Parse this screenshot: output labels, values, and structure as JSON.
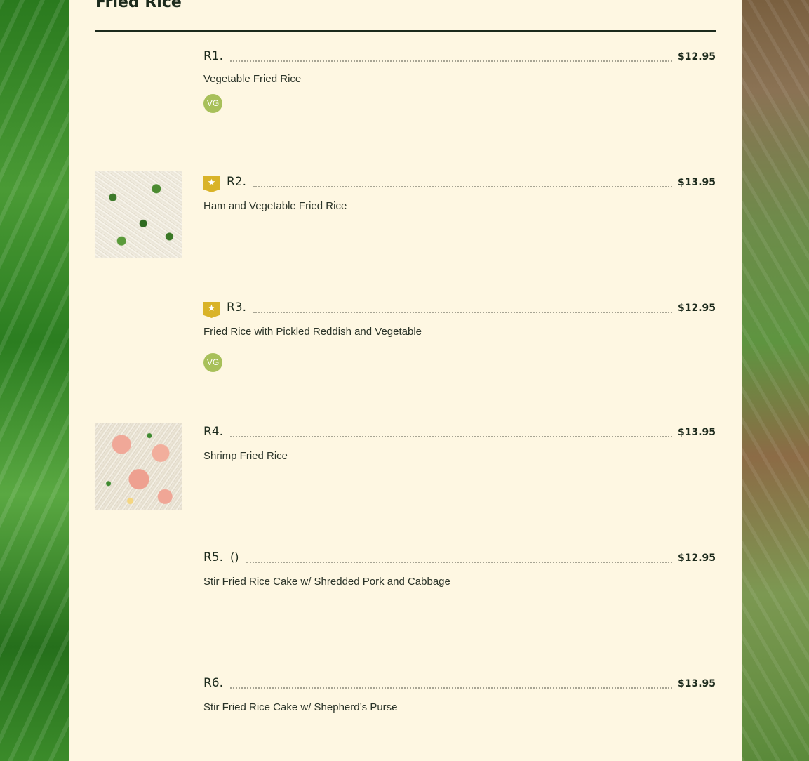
{
  "section": {
    "title": "Fried Rice"
  },
  "items": [
    {
      "code": "R1.",
      "price": "$12.95",
      "description": "Vegetable Fried Rice",
      "badge": "VG"
    },
    {
      "code": "R2.",
      "price": "$13.95",
      "description": "Ham and Vegetable Fried Rice",
      "star_icon": "star-icon"
    },
    {
      "code": "R3.",
      "price": "$12.95",
      "description": "Fried Rice with Pickled Reddish and Vegetable",
      "badge": "VG",
      "star_icon": "star-icon"
    },
    {
      "code": "R4.",
      "price": "$13.95",
      "description": "Shrimp Fried Rice"
    },
    {
      "code": "R5.",
      "subtitle": "()",
      "price": "$12.95",
      "description": "Stir Fried Rice Cake w/ Shredded Pork and Cabbage"
    },
    {
      "code": "R6.",
      "price": "$13.95",
      "description": "Stir Fried Rice Cake w/ Shepherd’s Purse"
    }
  ],
  "colors": {
    "panel_background": "#fef7e2",
    "text": "#1c2a1c",
    "star_badge": "#d9b328",
    "vg_badge": "#a8c05a"
  }
}
